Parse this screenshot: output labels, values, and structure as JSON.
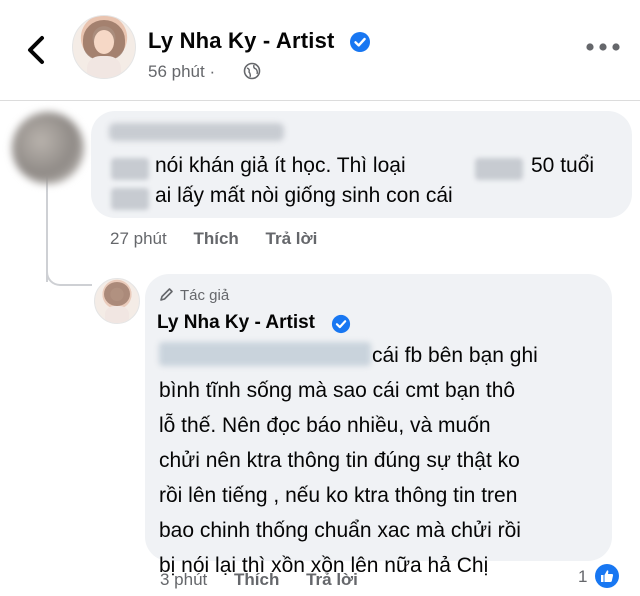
{
  "header": {
    "page_name": "Ly Nha Ky - Artist",
    "time": "56 phút",
    "separator": "·",
    "back_icon": "chevron-left-icon",
    "more_icon": "more-horizontal-icon",
    "privacy_icon": "globe-icon"
  },
  "comment": {
    "line1_a": "nói khán giả ít học.  Thì loại",
    "line1_b": "50 tuổi",
    "line2": "ai lấy mất nòi giống sinh con cái",
    "time": "27 phút",
    "like_label": "Thích",
    "reply_label": "Trả lời"
  },
  "reply": {
    "author_tag": "Tác giả",
    "name": "Ly Nha Ky - Artist",
    "lines": [
      "cái fb bên bạn ghi",
      "bình tĩnh sống mà sao cái cmt bạn thô",
      "lỗ thế. Nên đọc báo nhiều, và muốn",
      "chửi nên ktra thông tin đúng sự thật ko",
      "rồi lên tiếng , nếu ko ktra thông tin tren",
      "bao chinh thống chuẩn xac mà chửi rồi",
      "bị nói lại thì xồn xồn  lên nữa hả Chị"
    ],
    "time": "3 phút",
    "like_label": "Thích",
    "reply_label": "Trả lời",
    "reaction_count": "1",
    "reaction_icon": "like-icon"
  },
  "colors": {
    "verified": "#1877f2",
    "bubble": "#f0f2f5",
    "meta": "#65676b",
    "text": "#050505"
  }
}
